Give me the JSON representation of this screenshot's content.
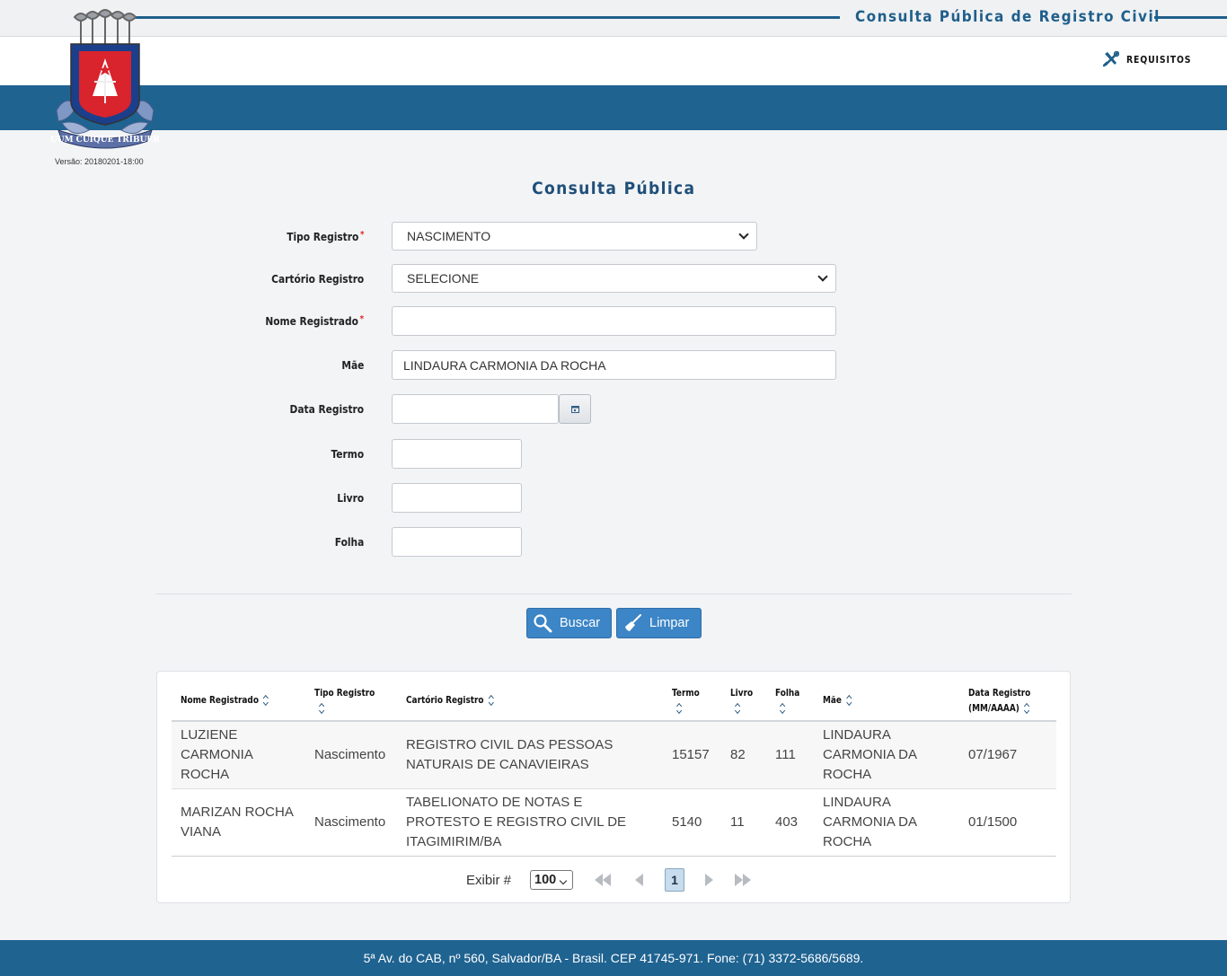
{
  "header": {
    "site_title": "Consulta Pública de Registro Civil",
    "requisitos_label": "REQUISITOS",
    "version": "Versão: 20180201-18:00",
    "logo_motto": "SUUM CUIQUE TRIBUERE"
  },
  "form": {
    "title": "Consulta Pública",
    "tipo_registro": {
      "label": "Tipo Registro",
      "value": "NASCIMENTO"
    },
    "cartorio_registro": {
      "label": "Cartório Registro",
      "value": "SELECIONE"
    },
    "nome_registrado": {
      "label": "Nome Registrado",
      "value": ""
    },
    "mae": {
      "label": "Mãe",
      "value": "LINDAURA CARMONIA DA ROCHA"
    },
    "data_registro": {
      "label": "Data Registro",
      "value": ""
    },
    "termo": {
      "label": "Termo",
      "value": ""
    },
    "livro": {
      "label": "Livro",
      "value": ""
    },
    "folha": {
      "label": "Folha",
      "value": ""
    },
    "required_mark": "*",
    "buscar_label": "Buscar",
    "limpar_label": "Limpar"
  },
  "table": {
    "headers": {
      "nome": "Nome Registrado",
      "tipo": "Tipo Registro",
      "cartorio": "Cartório Registro",
      "termo": "Termo",
      "livro": "Livro",
      "folha": "Folha",
      "mae": "Mãe",
      "data": "Data Registro",
      "data_sub": "(MM/AAAA)"
    },
    "rows": [
      {
        "nome": "LUZIENE CARMONIA ROCHA",
        "tipo": "Nascimento",
        "cartorio": "REGISTRO CIVIL DAS PESSOAS NATURAIS DE CANAVIEIRAS",
        "termo": "15157",
        "livro": "82",
        "folha": "111",
        "mae": "LINDAURA CARMONIA DA ROCHA",
        "data": "07/1967"
      },
      {
        "nome": "MARIZAN ROCHA VIANA",
        "tipo": "Nascimento",
        "cartorio": "TABELIONATO DE NOTAS E PROTESTO E REGISTRO CIVIL DE ITAGIMIRIM/BA",
        "termo": "5140",
        "livro": "11",
        "folha": "403",
        "mae": "LINDAURA CARMONIA DA ROCHA",
        "data": "01/1500"
      }
    ],
    "pager": {
      "exibir_label": "Exibir #",
      "page_size": "100",
      "current_page": "1"
    }
  },
  "footer": {
    "text": "5ª Av. do CAB, nº 560, Salvador/BA - Brasil. CEP 41745-971. Fone: (71) 3372-5686/5689."
  },
  "colors": {
    "brand_blue": "#1f6391",
    "button_blue": "#3c85c6",
    "title_blue": "#1f4f7a",
    "shield_red": "#d9232d"
  }
}
